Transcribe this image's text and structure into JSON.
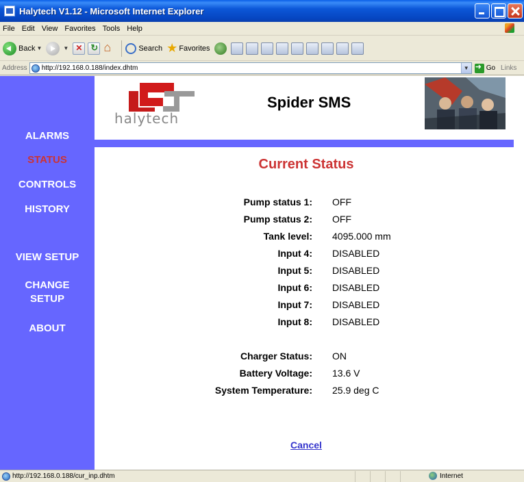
{
  "window": {
    "title": "Halytech V1.12 - Microsoft Internet Explorer"
  },
  "menu": [
    "File",
    "Edit",
    "View",
    "Favorites",
    "Tools",
    "Help"
  ],
  "toolbar": {
    "back_label": "Back",
    "search_label": "Search",
    "favorites_label": "Favorites"
  },
  "address": {
    "label": "Address",
    "url": "http://192.168.0.188/index.dhtm",
    "go_label": "Go",
    "links_label": "Links"
  },
  "brand": {
    "logo_text": "halytech",
    "product": "Spider SMS"
  },
  "nav": {
    "items": [
      {
        "label": "ALARMS",
        "active": false
      },
      {
        "label": "STATUS",
        "active": true
      },
      {
        "label": "CONTROLS",
        "active": false
      },
      {
        "label": "HISTORY",
        "active": false
      },
      {
        "label": "VIEW SETUP",
        "active": false
      },
      {
        "label": "CHANGE",
        "active": false
      },
      {
        "label": "SETUP",
        "active": false
      },
      {
        "label": "ABOUT",
        "active": false
      }
    ]
  },
  "status": {
    "title": "Current Status",
    "rows": [
      {
        "label": "Pump status 1:",
        "value": "OFF"
      },
      {
        "label": "Pump status 2:",
        "value": "OFF"
      },
      {
        "label": "Tank level:",
        "value": "4095.000 mm"
      },
      {
        "label": "Input 4:",
        "value": "DISABLED"
      },
      {
        "label": "Input 5:",
        "value": "DISABLED"
      },
      {
        "label": "Input 6:",
        "value": "DISABLED"
      },
      {
        "label": "Input 7:",
        "value": "DISABLED"
      },
      {
        "label": "Input 8:",
        "value": "DISABLED"
      }
    ],
    "system_rows": [
      {
        "label": "Charger Status:",
        "value": "ON"
      },
      {
        "label": "Battery Voltage:",
        "value": "13.6 V"
      },
      {
        "label": "System Temperature:",
        "value": "25.9 deg C"
      }
    ],
    "cancel_label": "Cancel"
  },
  "statusbar": {
    "url": "http://192.168.0.188/cur_inp.dhtm",
    "zone": "Internet"
  },
  "colors": {
    "nav_bg": "#6666FF",
    "active_nav": "#CC3333",
    "title": "#CC3333",
    "link": "#3333CC"
  }
}
